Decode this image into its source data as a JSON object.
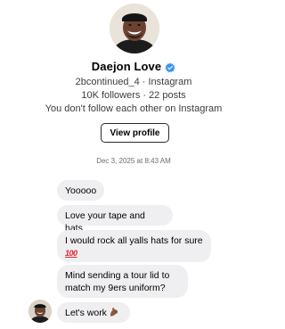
{
  "profile": {
    "name": "Daejon Love",
    "verified_icon": "verified-badge-icon",
    "username": "2bcontinued_4",
    "platform": "Instagram",
    "separator": "·",
    "followers": "10K followers",
    "posts": "22 posts",
    "follow_status": "You don't follow each other on Instagram",
    "view_profile_label": "View profile"
  },
  "thread": {
    "timestamp": "Dec 3, 2025 at 8:43 AM",
    "messages": [
      {
        "text": "Yooooo"
      },
      {
        "text": "Love your tape and hats"
      },
      {
        "text": "I would rock all yalls hats for sure",
        "emoji": "100",
        "emoji_icon": "hundred-points-icon"
      },
      {
        "text": "Mind sending a tour lid to match my 9ers uniform?"
      },
      {
        "text": "Let's work",
        "emoji_icon": "flexed-biceps-icon"
      }
    ]
  },
  "colors": {
    "bubble_bg": "#efeff1",
    "verified_blue": "#3897f0",
    "text_secondary": "#3c3c3c",
    "timestamp": "#6b6b6b",
    "emoji_red": "#e0292f"
  }
}
